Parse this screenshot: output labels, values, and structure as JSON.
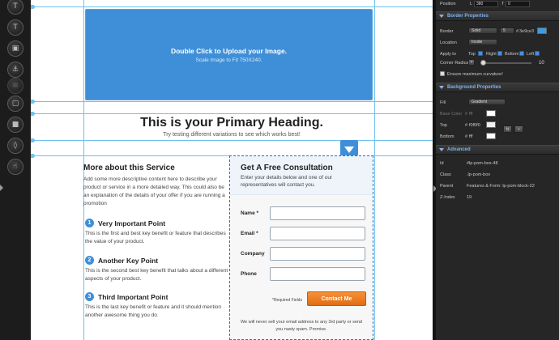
{
  "toolbar": {
    "tools": [
      "text-icon",
      "text-tool-icon",
      "image-icon",
      "anchor-icon",
      "form-icon",
      "box-icon",
      "video-icon",
      "code-icon",
      "social-icon"
    ]
  },
  "canvas": {
    "upload_title": "Double Click to Upload your Image.",
    "upload_sub": "Scale Image to Fit 750X240.",
    "primary_heading": "This is your Primary Heading.",
    "sub_heading": "Try testing different variations to see which works best!",
    "more_title": "More about this Service",
    "more_desc": "Add some more descriptive content here to describe your product or service in a more detailed way. This could also be an explanation of the details of your offer if you are running a promotion",
    "key_points": [
      {
        "num": "1",
        "title": "Very Important Point",
        "text": "This is the first and best key benefit or feature that describes the value of your product."
      },
      {
        "num": "2",
        "title": "Another Key Point",
        "text": "This is the second best key benefit that talks about a different aspects of your product."
      },
      {
        "num": "3",
        "title": "Third Important Point",
        "text": "This is the last key benefit or feature and it should mention another awesome thing you do."
      }
    ],
    "form": {
      "title": "Get A Free Consultation",
      "intro": "Enter your details below and one of our representatives will contact you.",
      "fields": [
        "Name *",
        "Email *",
        "Company",
        "Phone"
      ],
      "required_note": "*Required Fields",
      "button": "Contact Me",
      "footer": "We will never sell your email address to any 3rd party or send you nasty spam. Promise."
    }
  },
  "panel": {
    "position_label": "Position",
    "pos_l_label": "L",
    "pos_l": "380",
    "pos_t_label": "T",
    "pos_t": "0",
    "border_section": "Border Properties",
    "border_label": "Border",
    "border_style": "Solid",
    "border_width": "5",
    "border_color_hash": "#",
    "border_color": "3e9ce3",
    "location_label": "Location",
    "location": "Inside",
    "apply_to_label": "Apply to",
    "apply_top": "Top",
    "apply_right": "Right",
    "apply_bottom": "Bottom",
    "apply_left": "Left",
    "corner_radius_label": "Corner Radius",
    "corner_radius": "10",
    "max_curvature": "Ensure maximum curvature!",
    "background_section": "Background Properties",
    "fill_label": "Fill",
    "fill": "Gradient",
    "base_color_label": "Base Color",
    "base_color": "fff",
    "top_label": "Top",
    "top_color": "f0f0f0",
    "bottom_label": "Bottom",
    "bottom_color": "fff",
    "advanced_section": "Advanced",
    "id_label": "Id",
    "id_value": "#lp-pom-box-48",
    "class_label": "Class",
    "class_value": ".lp-pom-box",
    "parent_label": "Parent",
    "parent_value": "Features & Form: lp-pom-block-22",
    "zindex_label": "Z-Index",
    "zindex_value": "19",
    "colors": {
      "border": "#3e9ce3",
      "top": "#f0f0f0",
      "bottom": "#ffffff",
      "base": "#ffffff"
    }
  }
}
